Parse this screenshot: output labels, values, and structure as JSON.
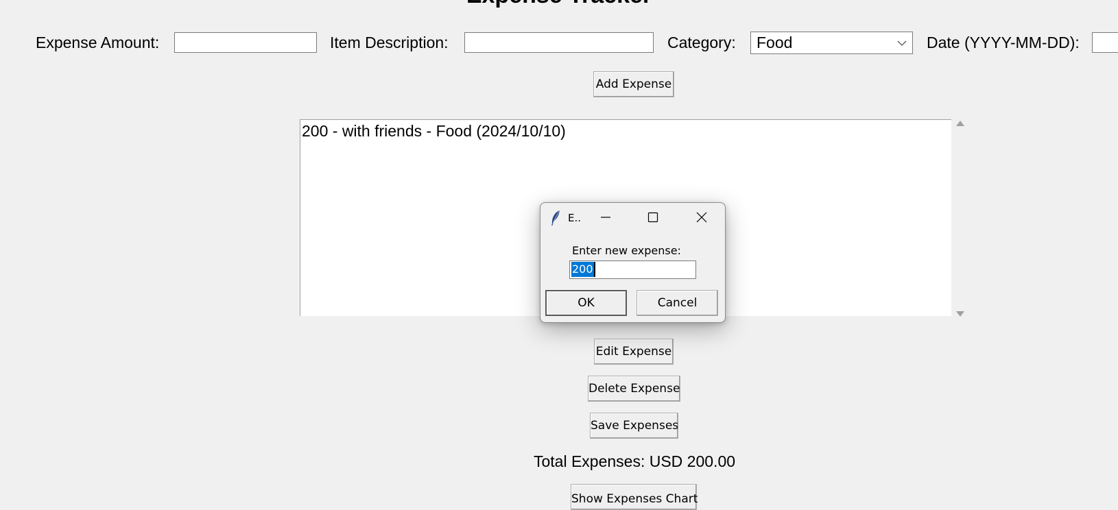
{
  "app": {
    "title": "Expense Tracker"
  },
  "form": {
    "amount_label": "Expense Amount:",
    "amount_value": "",
    "description_label": "Item Description:",
    "description_value": "",
    "category_label": "Category:",
    "category_value": "Food",
    "date_label": "Date (YYYY-MM-DD):",
    "date_value": ""
  },
  "buttons": {
    "add": "Add Expense",
    "edit": "Edit Expense",
    "delete": "Delete Expense",
    "save": "Save Expenses",
    "chart": "Show Expenses Chart"
  },
  "expenses_list": {
    "items": [
      "200 - with friends - Food (2024/10/10)"
    ]
  },
  "total": {
    "text": "Total Expenses: USD 200.00"
  },
  "dialog": {
    "title": "E..",
    "prompt": "Enter new expense:",
    "value": "200",
    "ok": "OK",
    "cancel": "Cancel"
  },
  "icons": {
    "app_icon": "tk-feather-icon",
    "minimize": "minimize-icon",
    "maximize": "maximize-icon",
    "close": "close-icon",
    "dropdown": "chevron-down-icon",
    "scroll_up": "scroll-up-arrow-icon",
    "scroll_down": "scroll-down-arrow-icon"
  },
  "colors": {
    "window_bg": "#f0f0f0",
    "selection": "#0078d7",
    "feather": "#2b4a86"
  }
}
